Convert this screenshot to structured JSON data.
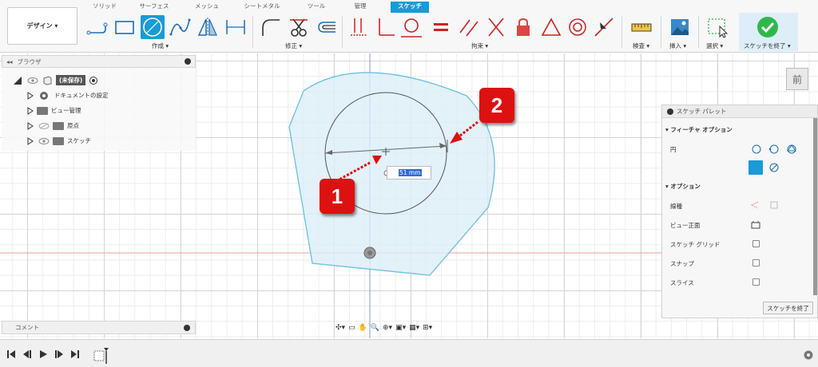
{
  "toolbar": {
    "workspace_label": "デザイン ▾",
    "tabs": [
      "ソリッド",
      "サーフェス",
      "メッシュ",
      "シートメタル",
      "ツール",
      "管理",
      "スケッチ"
    ],
    "groups": {
      "create": "作成 ▾",
      "modify": "修正 ▾",
      "constraints": "拘束 ▾",
      "inspect": "検査 ▾",
      "insert": "挿入 ▾",
      "select": "選択 ▾",
      "finish": "スケッチを終了 ▾"
    }
  },
  "browser": {
    "title": "ブラウザ",
    "root_label": "(未保存)",
    "items": [
      "ドキュメントの設定",
      "ビュー管理",
      "原点",
      "スケッチ"
    ]
  },
  "comment": {
    "label": "コメント"
  },
  "palette": {
    "title": "スケッチ パレット",
    "feature_options": "フィーチャ オプション",
    "circle_label": "円",
    "options_heading": "オプション",
    "rows": [
      "線種",
      "ビュー正面",
      "スケッチ グリッド",
      "スナップ",
      "スライス"
    ],
    "finish_button": "スケッチを終了"
  },
  "sketch": {
    "dimension_value": "51 mm"
  },
  "callouts": [
    "1",
    "2"
  ],
  "viewcube": {
    "face_label": "前"
  },
  "colors": {
    "accent": "#1a9ad6",
    "profile_fill": "#dceef8",
    "profile_stroke": "#6cbfe0",
    "callout_red": "#dd1111",
    "finish_check": "#2fb84a"
  }
}
